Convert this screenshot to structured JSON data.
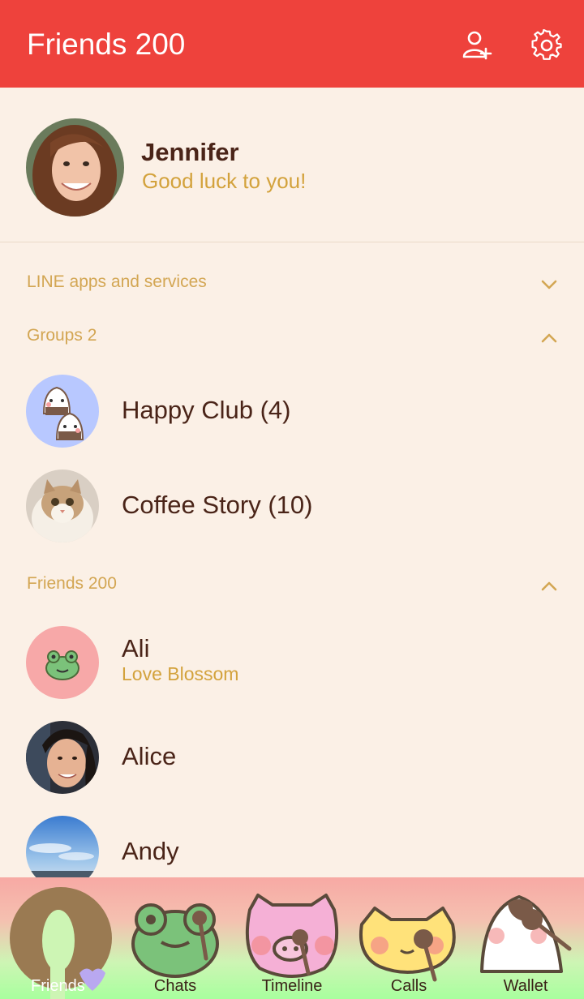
{
  "header": {
    "title": "Friends 200",
    "add_friend_icon": "add-friend-icon",
    "settings_icon": "gear-icon"
  },
  "profile": {
    "name": "Jennifer",
    "status": "Good luck to you!"
  },
  "sections": {
    "line_apps": {
      "label": "LINE apps and services",
      "expanded": false
    },
    "groups": {
      "label": "Groups 2",
      "expanded": true
    },
    "friends": {
      "label": "Friends 200",
      "expanded": true
    }
  },
  "groups": [
    {
      "name": "Happy Club (4)"
    },
    {
      "name": "Coffee Story (10)"
    }
  ],
  "friends": [
    {
      "name": "Ali",
      "status": "Love Blossom"
    },
    {
      "name": "Alice",
      "status": ""
    },
    {
      "name": "Andy",
      "status": ""
    }
  ],
  "tabs": [
    {
      "label": "Friends",
      "active": true
    },
    {
      "label": "Chats",
      "active": false
    },
    {
      "label": "Timeline",
      "active": false
    },
    {
      "label": "Calls",
      "active": false
    },
    {
      "label": "Wallet",
      "active": false
    }
  ],
  "colors": {
    "header": "#ee423c",
    "background": "#fbf0e6",
    "accent_text": "#d3a23c",
    "name_text": "#4a2418"
  }
}
